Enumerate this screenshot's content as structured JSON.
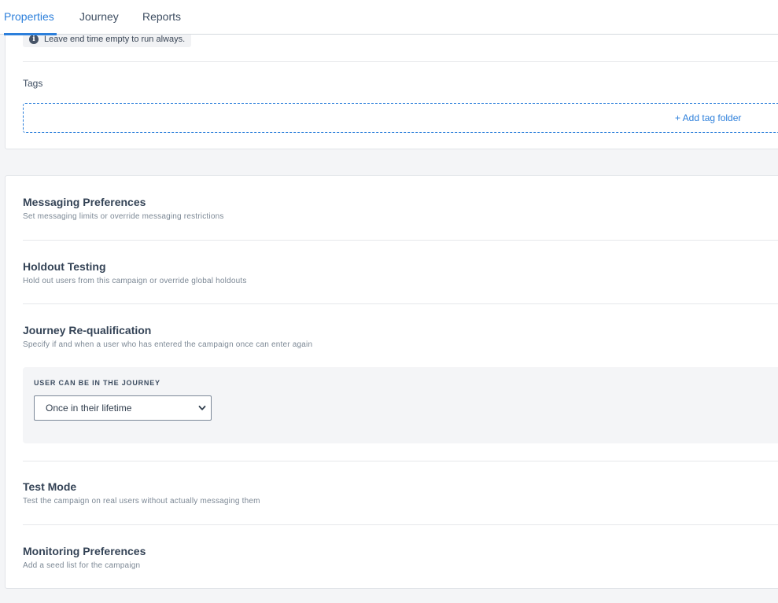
{
  "tabs": [
    {
      "label": "Properties",
      "active": true
    },
    {
      "label": "Journey",
      "active": false
    },
    {
      "label": "Reports",
      "active": false
    }
  ],
  "schedule": {
    "info_icon": "info-icon",
    "note": "Leave end time empty to run always."
  },
  "tags": {
    "label": "Tags",
    "add_label": "+ Add tag folder"
  },
  "sections": {
    "messaging": {
      "title": "Messaging Preferences",
      "desc": "Set messaging limits or override messaging restrictions"
    },
    "holdout": {
      "title": "Holdout Testing",
      "desc": "Hold out users from this campaign or override global holdouts"
    },
    "requalification": {
      "title": "Journey Re-qualification",
      "desc": "Specify if and when a user who has entered the campaign once can enter again",
      "field_label": "USER CAN BE IN THE JOURNEY",
      "selected": "Once in their lifetime"
    },
    "test_mode": {
      "title": "Test Mode",
      "desc": "Test the campaign on real users without actually messaging them"
    },
    "monitoring": {
      "title": "Monitoring Preferences",
      "desc": "Add a seed list for the campaign"
    }
  },
  "colors": {
    "accent": "#2c7fdb",
    "background": "#f4f5f7",
    "text": "#344356"
  }
}
